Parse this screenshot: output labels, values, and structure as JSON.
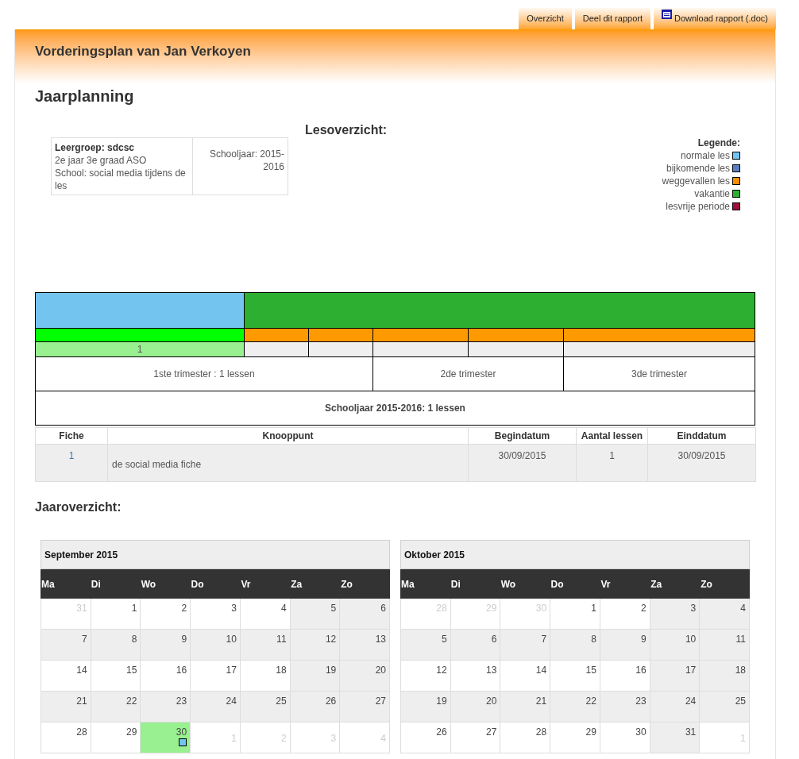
{
  "top_links": [
    {
      "label": "Overzicht",
      "kind": "link"
    },
    {
      "label": "Deel dit rapport",
      "kind": "link"
    },
    {
      "label": "Download rapport (.doc)",
      "kind": "download"
    }
  ],
  "header": {
    "title": "Vorderingsplan van Jan Verkoyen"
  },
  "section_title": "Jaarplanning",
  "group_info": {
    "group": "Leergroep: sdcsc",
    "grade": "2e jaar 3e graad ASO",
    "school": "School: social media tijdens de les",
    "school_year": "Schooljaar: 2015-2016"
  },
  "overview_title": "Lesoverzicht:",
  "legend": {
    "title": "Legende:",
    "items": [
      {
        "label": "normale les",
        "color": "#73c5f0"
      },
      {
        "label": "bijkomende les",
        "color": "#5b7fc4"
      },
      {
        "label": "weggevallen les",
        "color": "#ff8c00"
      },
      {
        "label": "vakantie",
        "color": "#2db032"
      },
      {
        "label": "lesvrije periode",
        "color": "#a0103a"
      }
    ]
  },
  "timeline": {
    "periods": [
      {
        "color": "#73c5f0"
      },
      {
        "color": "#2db032"
      }
    ],
    "weeks": [
      {
        "color": "#00ff00"
      },
      {
        "color": "#ff9900"
      },
      {
        "color": "#ff9900"
      },
      {
        "color": "#ff9900"
      },
      {
        "color": "#ff9900"
      },
      {
        "color": "#ff9900"
      }
    ],
    "counts": [
      {
        "count": "1",
        "color": "#98f090"
      },
      {
        "color": "#efefef"
      },
      {
        "color": "#efefef"
      },
      {
        "color": "#efefef"
      },
      {
        "color": "#efefef"
      },
      {
        "color": "#efefef"
      }
    ],
    "trimesters": [
      "1ste trimester : 1 lessen",
      "2de trimester",
      "3de trimester"
    ],
    "total": "Schooljaar 2015-2016: 1 lessen"
  },
  "lessons_table": {
    "columns": [
      "Fiche",
      "Knooppunt",
      "Begindatum",
      "Aantal lessen",
      "Einddatum"
    ],
    "rows": [
      [
        "1",
        "de social media fiche",
        "30/09/2015",
        "1",
        "30/09/2015"
      ]
    ]
  },
  "year_title": "Jaaroverzicht:",
  "calendars": [
    {
      "title": "September 2015",
      "weekdays": [
        "Ma",
        "Di",
        "Wo",
        "Do",
        "Vr",
        "Za",
        "Zo"
      ],
      "weeks": [
        [
          {
            "day": "31",
            "outside": true,
            "lesson": false
          },
          {
            "day": "1",
            "outside": false,
            "lesson": false
          },
          {
            "day": "2",
            "outside": false,
            "lesson": false
          },
          {
            "day": "3",
            "outside": false,
            "lesson": false
          },
          {
            "day": "4",
            "outside": false,
            "lesson": false
          },
          {
            "day": "5",
            "outside": false,
            "lesson": false
          },
          {
            "day": "6",
            "outside": false,
            "lesson": false
          }
        ],
        [
          {
            "day": "7",
            "outside": false,
            "lesson": false
          },
          {
            "day": "8",
            "outside": false,
            "lesson": false
          },
          {
            "day": "9",
            "outside": false,
            "lesson": false
          },
          {
            "day": "10",
            "outside": false,
            "lesson": false
          },
          {
            "day": "11",
            "outside": false,
            "lesson": false
          },
          {
            "day": "12",
            "outside": false,
            "lesson": false
          },
          {
            "day": "13",
            "outside": false,
            "lesson": false
          }
        ],
        [
          {
            "day": "14",
            "outside": false,
            "lesson": false
          },
          {
            "day": "15",
            "outside": false,
            "lesson": false
          },
          {
            "day": "16",
            "outside": false,
            "lesson": false
          },
          {
            "day": "17",
            "outside": false,
            "lesson": false
          },
          {
            "day": "18",
            "outside": false,
            "lesson": false
          },
          {
            "day": "19",
            "outside": false,
            "lesson": false
          },
          {
            "day": "20",
            "outside": false,
            "lesson": false
          }
        ],
        [
          {
            "day": "21",
            "outside": false,
            "lesson": false
          },
          {
            "day": "22",
            "outside": false,
            "lesson": false
          },
          {
            "day": "23",
            "outside": false,
            "lesson": false
          },
          {
            "day": "24",
            "outside": false,
            "lesson": false
          },
          {
            "day": "25",
            "outside": false,
            "lesson": false
          },
          {
            "day": "26",
            "outside": false,
            "lesson": false
          },
          {
            "day": "27",
            "outside": false,
            "lesson": false
          }
        ],
        [
          {
            "day": "28",
            "outside": false,
            "lesson": false
          },
          {
            "day": "29",
            "outside": false,
            "lesson": false
          },
          {
            "day": "30",
            "outside": false,
            "lesson": true
          },
          {
            "day": "1",
            "outside": true,
            "lesson": false
          },
          {
            "day": "2",
            "outside": true,
            "lesson": false
          },
          {
            "day": "3",
            "outside": true,
            "lesson": false
          },
          {
            "day": "4",
            "outside": true,
            "lesson": false
          }
        ]
      ]
    },
    {
      "title": "Oktober 2015",
      "weekdays": [
        "Ma",
        "Di",
        "Wo",
        "Do",
        "Vr",
        "Za",
        "Zo"
      ],
      "weeks": [
        [
          {
            "day": "28",
            "outside": true,
            "lesson": false
          },
          {
            "day": "29",
            "outside": true,
            "lesson": false
          },
          {
            "day": "30",
            "outside": true,
            "lesson": false
          },
          {
            "day": "1",
            "outside": false,
            "lesson": false
          },
          {
            "day": "2",
            "outside": false,
            "lesson": false
          },
          {
            "day": "3",
            "outside": false,
            "lesson": false
          },
          {
            "day": "4",
            "outside": false,
            "lesson": false
          }
        ],
        [
          {
            "day": "5",
            "outside": false,
            "lesson": false
          },
          {
            "day": "6",
            "outside": false,
            "lesson": false
          },
          {
            "day": "7",
            "outside": false,
            "lesson": false
          },
          {
            "day": "8",
            "outside": false,
            "lesson": false
          },
          {
            "day": "9",
            "outside": false,
            "lesson": false
          },
          {
            "day": "10",
            "outside": false,
            "lesson": false
          },
          {
            "day": "11",
            "outside": false,
            "lesson": false
          }
        ],
        [
          {
            "day": "12",
            "outside": false,
            "lesson": false
          },
          {
            "day": "13",
            "outside": false,
            "lesson": false
          },
          {
            "day": "14",
            "outside": false,
            "lesson": false
          },
          {
            "day": "15",
            "outside": false,
            "lesson": false
          },
          {
            "day": "16",
            "outside": false,
            "lesson": false
          },
          {
            "day": "17",
            "outside": false,
            "lesson": false
          },
          {
            "day": "18",
            "outside": false,
            "lesson": false
          }
        ],
        [
          {
            "day": "19",
            "outside": false,
            "lesson": false
          },
          {
            "day": "20",
            "outside": false,
            "lesson": false
          },
          {
            "day": "21",
            "outside": false,
            "lesson": false
          },
          {
            "day": "22",
            "outside": false,
            "lesson": false
          },
          {
            "day": "23",
            "outside": false,
            "lesson": false
          },
          {
            "day": "24",
            "outside": false,
            "lesson": false
          },
          {
            "day": "25",
            "outside": false,
            "lesson": false
          }
        ],
        [
          {
            "day": "26",
            "outside": false,
            "lesson": false
          },
          {
            "day": "27",
            "outside": false,
            "lesson": false
          },
          {
            "day": "28",
            "outside": false,
            "lesson": false
          },
          {
            "day": "29",
            "outside": false,
            "lesson": false
          },
          {
            "day": "30",
            "outside": false,
            "lesson": false
          },
          {
            "day": "31",
            "outside": false,
            "lesson": false
          },
          {
            "day": "1",
            "outside": true,
            "lesson": false
          }
        ]
      ]
    }
  ]
}
